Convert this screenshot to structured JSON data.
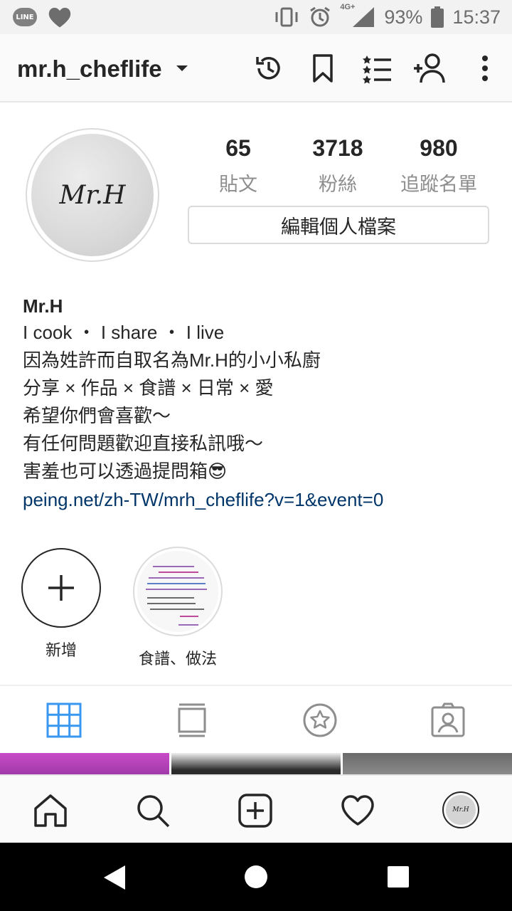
{
  "status_bar": {
    "line_label": "LINE",
    "network": "4G+",
    "battery": "93%",
    "time": "15:37"
  },
  "header": {
    "username": "mr.h_cheflife",
    "icons": [
      "history-icon",
      "bookmark-icon",
      "list-icon",
      "add-user-icon",
      "more-icon"
    ]
  },
  "profile": {
    "avatar_text": "Mr.H",
    "stats": [
      {
        "value": "65",
        "label": "貼文"
      },
      {
        "value": "3718",
        "label": "粉絲"
      },
      {
        "value": "980",
        "label": "追蹤名單"
      }
    ],
    "edit_button": "編輯個人檔案",
    "name": "Mr.H",
    "bio_lines": [
      "I cook ・ I share ・ I live",
      "因為姓許而自取名為Mr.H的小小私廚",
      "分享 × 作品 × 食譜 × 日常 × 愛",
      "希望你們會喜歡～",
      "有任何問題歡迎直接私訊哦～",
      "害羞也可以透過提問箱😎"
    ],
    "link": "peing.net/zh-TW/mrh_cheflife?v=1&event=0"
  },
  "highlights": [
    {
      "label": "新增"
    },
    {
      "label": "食譜、做法"
    }
  ],
  "colors": {
    "accent": "#3897f0",
    "link": "#003569",
    "muted": "#8e8e8e"
  }
}
